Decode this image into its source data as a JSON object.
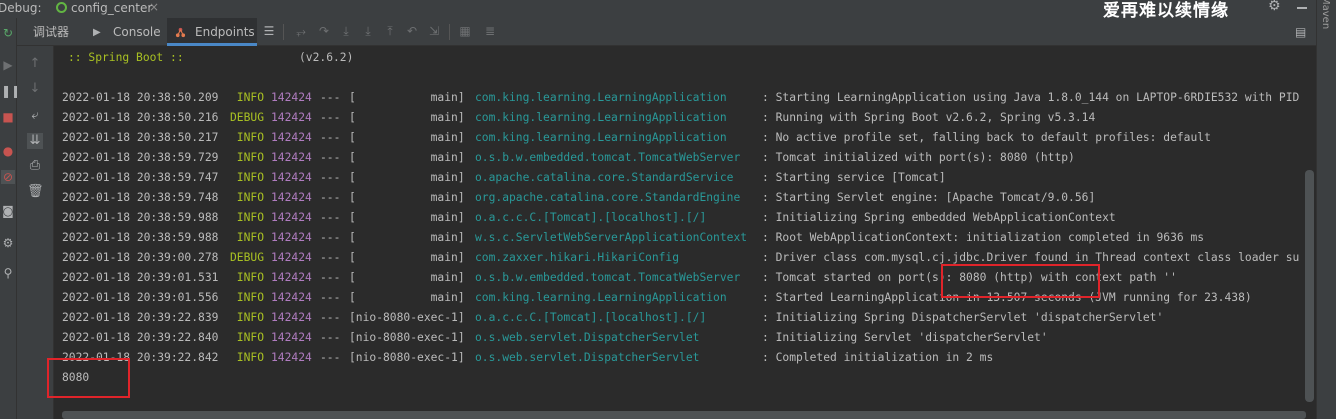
{
  "topbar": {
    "debug_label": "Debug:",
    "config_name": "config_center",
    "close_glyph": "×",
    "watermark": "爱再难以续情缘"
  },
  "side_panel_label": "Maven",
  "tabs": [
    {
      "label": "调试器",
      "icon": "debugger-icon"
    },
    {
      "label": "Console",
      "icon": "console-icon"
    },
    {
      "label": "Endpoints",
      "icon": "endpoints-icon",
      "active": true
    }
  ],
  "banner": {
    "name": ":: Spring Boot ::",
    "version": "(v2.6.2)"
  },
  "log_lines": [
    {
      "ts": "2022-01-18 20:38:50.209",
      "level": " INFO",
      "pid": "142424",
      "sep": "---",
      "thread": "[           main]",
      "logger": "com.king.learning.LearningApplication",
      "msg": ": Starting LearningApplication using Java 1.8.0_144 on LAPTOP-6RDIE532 with PID"
    },
    {
      "ts": "2022-01-18 20:38:50.216",
      "level": "DEBUG",
      "pid": "142424",
      "sep": "---",
      "thread": "[           main]",
      "logger": "com.king.learning.LearningApplication",
      "msg": ": Running with Spring Boot v2.6.2, Spring v5.3.14"
    },
    {
      "ts": "2022-01-18 20:38:50.217",
      "level": " INFO",
      "pid": "142424",
      "sep": "---",
      "thread": "[           main]",
      "logger": "com.king.learning.LearningApplication",
      "msg": ": No active profile set, falling back to default profiles: default"
    },
    {
      "ts": "2022-01-18 20:38:59.729",
      "level": " INFO",
      "pid": "142424",
      "sep": "---",
      "thread": "[           main]",
      "logger": "o.s.b.w.embedded.tomcat.TomcatWebServer",
      "msg": ": Tomcat initialized with port(s): 8080 (http)"
    },
    {
      "ts": "2022-01-18 20:38:59.747",
      "level": " INFO",
      "pid": "142424",
      "sep": "---",
      "thread": "[           main]",
      "logger": "o.apache.catalina.core.StandardService",
      "msg": ": Starting service [Tomcat]"
    },
    {
      "ts": "2022-01-18 20:38:59.748",
      "level": " INFO",
      "pid": "142424",
      "sep": "---",
      "thread": "[           main]",
      "logger": "org.apache.catalina.core.StandardEngine",
      "msg": ": Starting Servlet engine: [Apache Tomcat/9.0.56]"
    },
    {
      "ts": "2022-01-18 20:38:59.988",
      "level": " INFO",
      "pid": "142424",
      "sep": "---",
      "thread": "[           main]",
      "logger": "o.a.c.c.C.[Tomcat].[localhost].[/]",
      "msg": ": Initializing Spring embedded WebApplicationContext"
    },
    {
      "ts": "2022-01-18 20:38:59.988",
      "level": " INFO",
      "pid": "142424",
      "sep": "---",
      "thread": "[           main]",
      "logger": "w.s.c.ServletWebServerApplicationContext",
      "msg": ": Root WebApplicationContext: initialization completed in 9636 ms"
    },
    {
      "ts": "2022-01-18 20:39:00.278",
      "level": "DEBUG",
      "pid": "142424",
      "sep": "---",
      "thread": "[           main]",
      "logger": "com.zaxxer.hikari.HikariConfig",
      "msg": ": Driver class com.mysql.cj.jdbc.Driver found in Thread context class loader su"
    },
    {
      "ts": "2022-01-18 20:39:01.531",
      "level": " INFO",
      "pid": "142424",
      "sep": "---",
      "thread": "[           main]",
      "logger": "o.s.b.w.embedded.tomcat.TomcatWebServer",
      "msg": ": Tomcat started on port(s): 8080 (http) with context path ''"
    },
    {
      "ts": "2022-01-18 20:39:01.556",
      "level": " INFO",
      "pid": "142424",
      "sep": "---",
      "thread": "[           main]",
      "logger": "com.king.learning.LearningApplication",
      "msg": ": Started LearningApplication in 13.507 seconds (JVM running for 23.438)"
    },
    {
      "ts": "2022-01-18 20:39:22.839",
      "level": " INFO",
      "pid": "142424",
      "sep": "---",
      "thread": "[nio-8080-exec-1]",
      "logger": "o.a.c.c.C.[Tomcat].[localhost].[/]",
      "msg": ": Initializing Spring DispatcherServlet 'dispatcherServlet'"
    },
    {
      "ts": "2022-01-18 20:39:22.840",
      "level": " INFO",
      "pid": "142424",
      "sep": "---",
      "thread": "[nio-8080-exec-1]",
      "logger": "o.s.web.servlet.DispatcherServlet",
      "msg": ": Initializing Servlet 'dispatcherServlet'"
    },
    {
      "ts": "2022-01-18 20:39:22.842",
      "level": " INFO",
      "pid": "142424",
      "sep": "---",
      "thread": "[nio-8080-exec-1]",
      "logger": "o.s.web.servlet.DispatcherServlet",
      "msg": ": Completed initialization in 2 ms"
    }
  ],
  "output_value": "8080",
  "colors": {
    "background": "#2b2b2b",
    "level": "#a8c023",
    "pid": "#b07cc0",
    "logger": "#299999",
    "text": "#bbbbbb",
    "highlight_box": "#e0242a"
  }
}
